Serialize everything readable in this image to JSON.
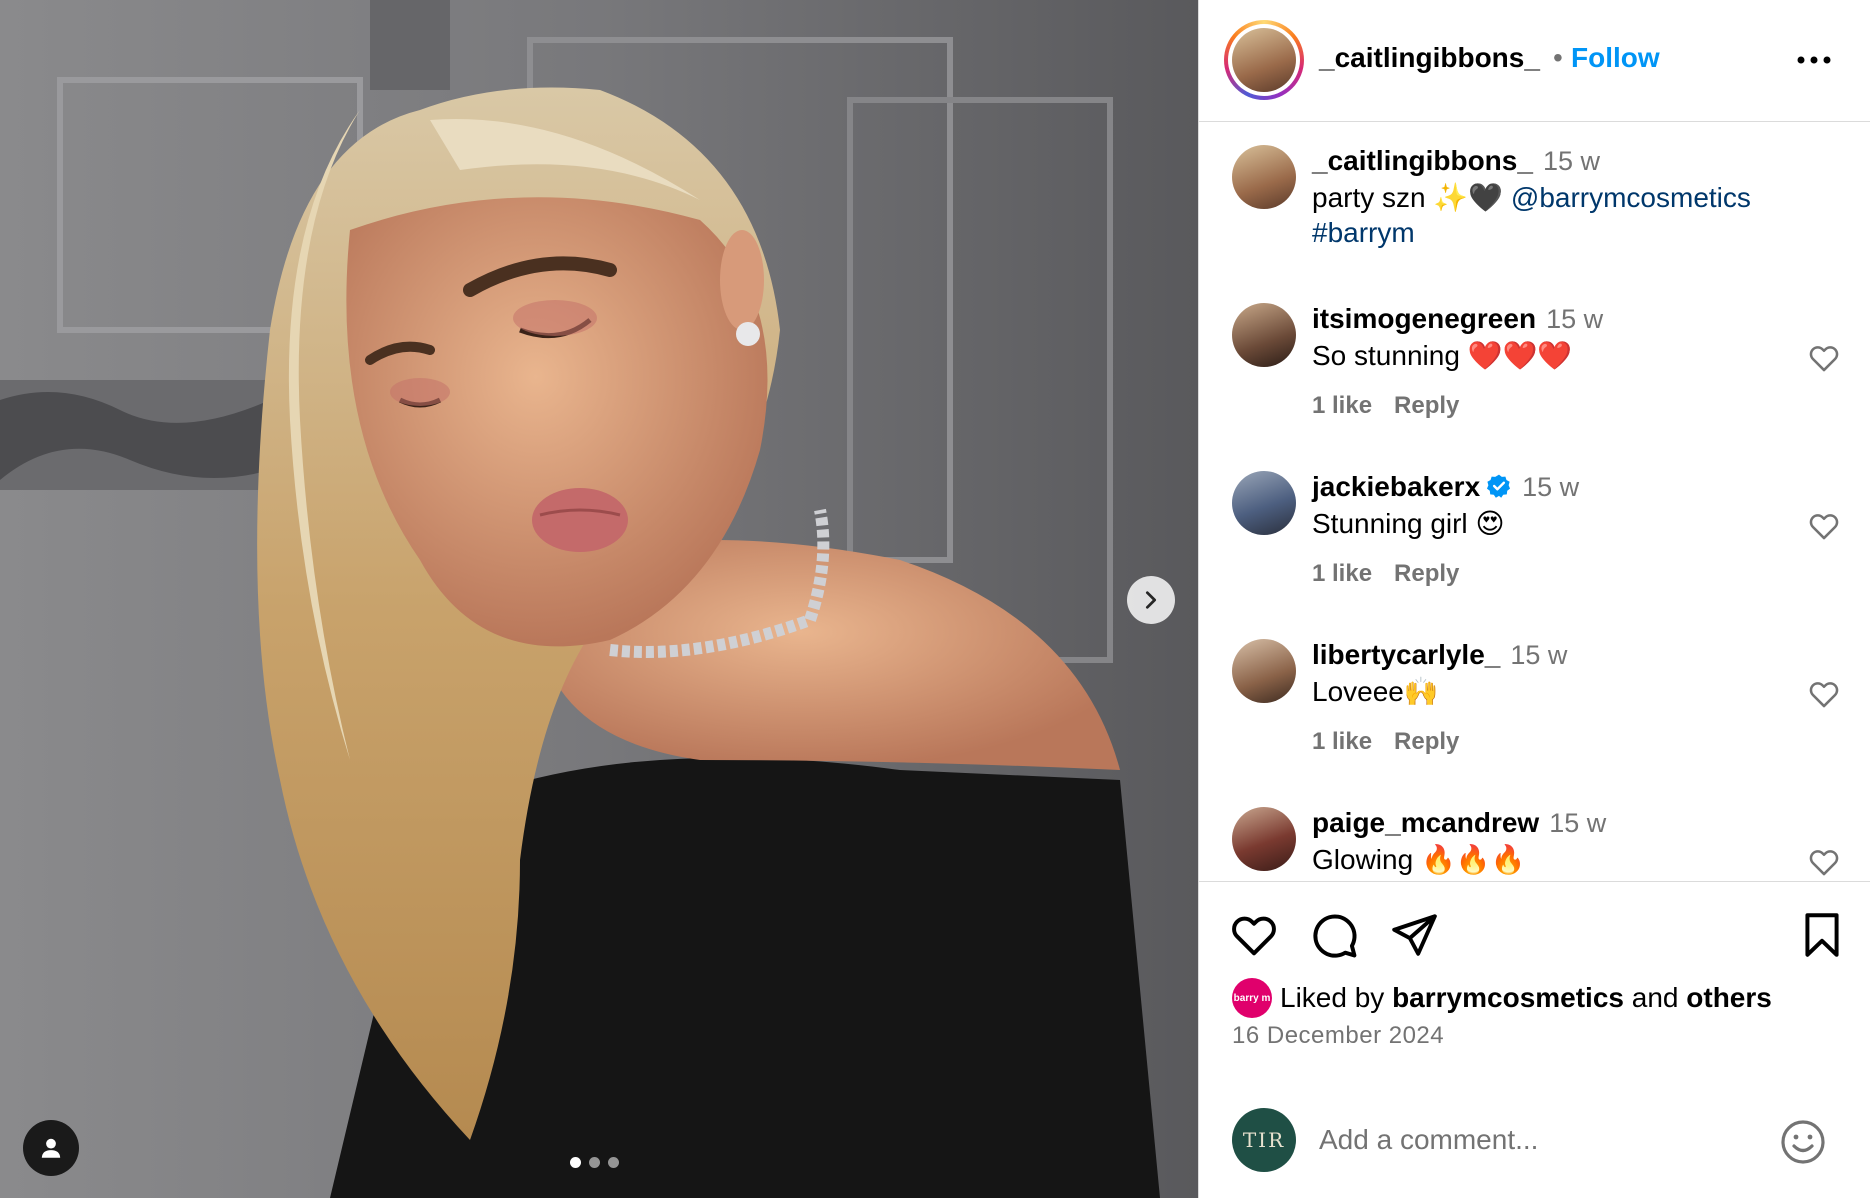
{
  "header": {
    "username": "_caitlingibbons_",
    "separator": "•",
    "follow_label": "Follow",
    "more_icon": "more-horizontal-icon"
  },
  "caption": {
    "username": "_caitlingibbons_",
    "time": "15 w",
    "text": "party szn ✨🖤",
    "mention": "@barrymcosmetics",
    "hashtag": "#barrym"
  },
  "comments": [
    {
      "username": "itsimogenegreen",
      "time": "15 w",
      "text": "So stunning ❤️❤️❤️",
      "likes": "1 like",
      "reply": "Reply",
      "verified": false
    },
    {
      "username": "jackiebakerx",
      "time": "15 w",
      "text": "Stunning girl 😍",
      "likes": "1 like",
      "reply": "Reply",
      "verified": true
    },
    {
      "username": "libertycarlyle_",
      "time": "15 w",
      "text": "Loveee🙌",
      "likes": "1 like",
      "reply": "Reply",
      "verified": false
    },
    {
      "username": "paige_mcandrew",
      "time": "15 w",
      "text": "Glowing 🔥🔥🔥",
      "likes": "",
      "reply": "",
      "verified": false
    }
  ],
  "likes": {
    "prefix": "Liked by",
    "user": "barrymcosmetics",
    "conj": "and",
    "others": "others",
    "avatar_label": "barry m"
  },
  "date": "16 December 2024",
  "add_comment": {
    "avatar_label": "TIR",
    "placeholder": "Add a comment..."
  },
  "carousel": {
    "total": 3,
    "active": 1
  },
  "colors": {
    "accent": "#0095f6",
    "muted": "#737373",
    "mention": "#00376b",
    "border": "#dbdbdb"
  }
}
